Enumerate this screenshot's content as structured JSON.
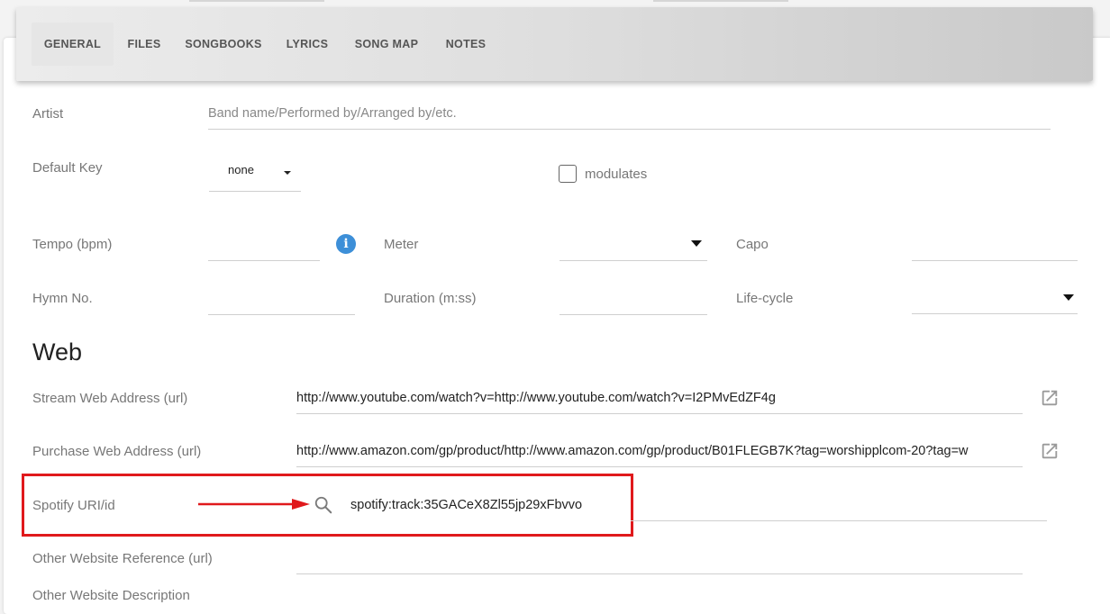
{
  "tabs": [
    {
      "label": "GENERAL",
      "active": true
    },
    {
      "label": "FILES",
      "active": false
    },
    {
      "label": "SONGBOOKS",
      "active": false
    },
    {
      "label": "LYRICS",
      "active": false
    },
    {
      "label": "SONG MAP",
      "active": false
    },
    {
      "label": "NOTES",
      "active": false
    }
  ],
  "artist": {
    "label": "Artist",
    "placeholder": "Band name/Performed by/Arranged by/etc."
  },
  "default_key": {
    "label": "Default Key",
    "value": "none"
  },
  "modulates": {
    "label": "modulates",
    "checked": false
  },
  "tempo": {
    "label": "Tempo (bpm)",
    "value": "",
    "info_icon": "info-icon"
  },
  "meter": {
    "label": "Meter",
    "value": ""
  },
  "capo": {
    "label": "Capo",
    "value": ""
  },
  "hymn_no": {
    "label": "Hymn No.",
    "value": ""
  },
  "duration": {
    "label": "Duration (m:ss)",
    "value": ""
  },
  "life_cycle": {
    "label": "Life-cycle",
    "value": ""
  },
  "web": {
    "title": "Web",
    "stream": {
      "label": "Stream Web Address (url)",
      "value": "http://www.youtube.com/watch?v=http://www.youtube.com/watch?v=I2PMvEdZF4g",
      "icon": "open-external-icon"
    },
    "purchase": {
      "label": "Purchase Web Address (url)",
      "value": "http://www.amazon.com/gp/product/http://www.amazon.com/gp/product/B01FLEGB7K?tag=worshipplcom-20?tag=w",
      "icon": "open-external-icon"
    },
    "spotify": {
      "label": "Spotify URI/id",
      "value": "spotify:track:35GACeX8Zl55jp29xFbvvo",
      "icon": "search-icon"
    },
    "other_ref": {
      "label": "Other Website Reference (url)",
      "value": ""
    },
    "other_desc": {
      "label": "Other Website Description",
      "value": ""
    }
  },
  "colors": {
    "highlight": "#e0191c",
    "info": "#3d8fd8"
  }
}
